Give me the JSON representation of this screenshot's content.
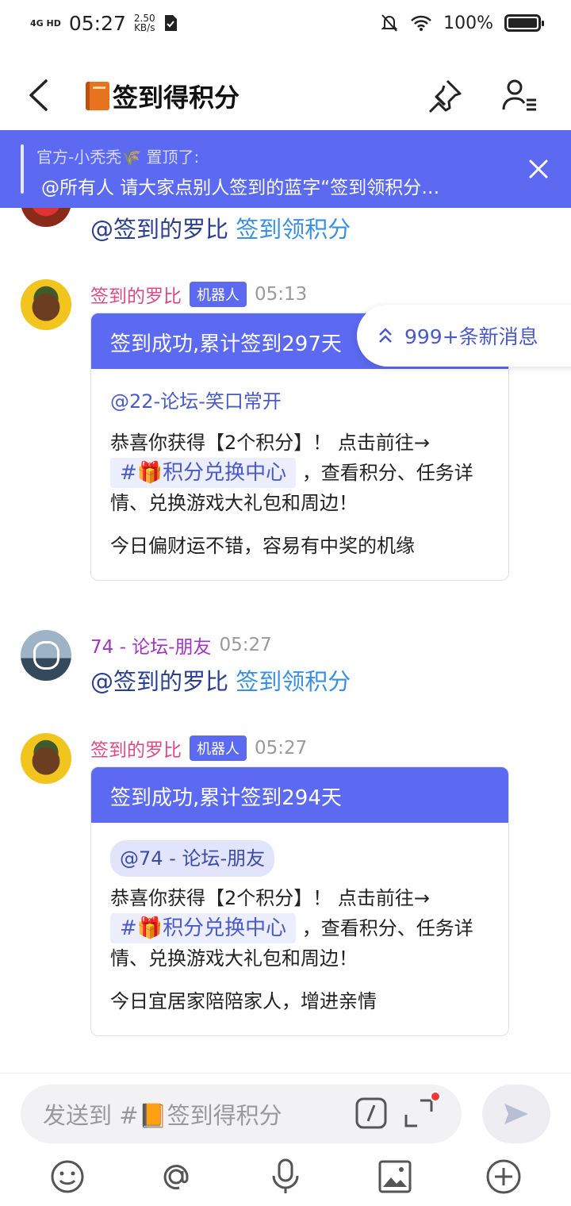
{
  "status_bar": {
    "network": "4G HD",
    "time": "05:27",
    "speed_value": "2.50",
    "speed_unit": "KB/s",
    "battery": "100%"
  },
  "header": {
    "title": "签到得积分"
  },
  "pinned": {
    "meta": "官方-小秃秃🌾 置顶了:",
    "text": "@所有人 请大家点别人签到的蓝字“签到领积分…"
  },
  "messages": [
    {
      "mention": "@签到的罗比",
      "link": "签到领积分"
    },
    {
      "sender": "签到的罗比",
      "badge": "机器人",
      "time": "05:13",
      "card_title": "签到成功,累计签到297天",
      "card_mention": "@22-论坛-笑口常开",
      "line1": "恭喜你获得【2个积分】！ 点击前往→",
      "channel_link": "#🎁积分兑换中心",
      "line2": "，查看积分、任务详情、兑换游戏大礼包和周边！",
      "fortune": "今日偏财运不错，容易有中奖的机缘"
    },
    {
      "sender": "74 - 论坛-朋友",
      "time": "05:27",
      "mention": "@签到的罗比",
      "link": "签到领积分"
    },
    {
      "sender": "签到的罗比",
      "badge": "机器人",
      "time": "05:27",
      "card_title": "签到成功,累计签到294天",
      "card_mention": "@74 - 论坛-朋友",
      "line1": "恭喜你获得【2个积分】！ 点击前往→",
      "channel_link": "#🎁积分兑换中心",
      "line2": "，查看积分、任务详情、兑换游戏大礼包和周边！",
      "fortune": "今日宜居家陪陪家人，增进亲情"
    }
  ],
  "new_messages": "999+条新消息",
  "composer": {
    "placeholder": "发送到 #📙签到得积分"
  },
  "colors": {
    "accent": "#5b6af0",
    "name_pink": "#e04a84",
    "name_purple": "#a233c9",
    "link_blue": "#3b8fe0"
  },
  "icons": [
    "back-arrow-icon",
    "pin-icon",
    "member-list-icon",
    "close-icon",
    "chevron-up-double-icon",
    "slash-command-icon",
    "expand-icon",
    "send-icon",
    "emoji-icon",
    "at-icon",
    "mic-icon",
    "image-icon",
    "plus-icon"
  ]
}
